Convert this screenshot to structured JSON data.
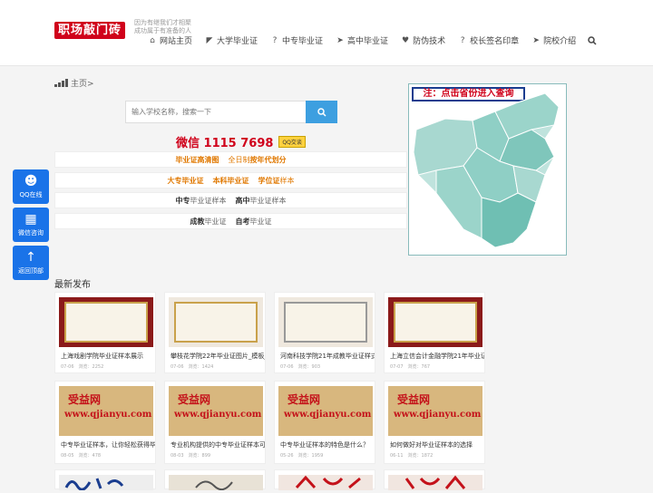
{
  "top_left_mark": "<",
  "logo": "职场敲门砖",
  "slogan": "因为有继我们才相聚 成功属于有准备的人",
  "nav": [
    {
      "icon": "home-icon",
      "glyph": "⌂",
      "label": "网站主页"
    },
    {
      "icon": "megaphone-icon",
      "glyph": "◤",
      "label": "大学毕业证"
    },
    {
      "icon": "question-circle-icon",
      "glyph": "?",
      "label": "中专毕业证"
    },
    {
      "icon": "paper-plane-icon",
      "glyph": "➤",
      "label": "高中毕业证"
    },
    {
      "icon": "heart-icon",
      "glyph": "♥",
      "label": "防伪技术"
    },
    {
      "icon": "question-circle-icon",
      "glyph": "?",
      "label": "校长签名印章"
    },
    {
      "icon": "paper-plane-icon",
      "glyph": "➤",
      "label": "院校介绍"
    }
  ],
  "breadcrumb": "主页>",
  "search": {
    "placeholder": "输入学校名称，搜索一下"
  },
  "wechat": {
    "text": "微信 1115 7698",
    "qq": "QQ交谈"
  },
  "rows": {
    "r1": {
      "a": "毕业证高清图",
      "b": "全日制",
      "c": "按年代划分"
    },
    "r2": {
      "a": "大专毕业证",
      "b": "本科毕业证",
      "c": "学位证",
      "d": "样本"
    },
    "r3": {
      "a": "中专",
      "b": "毕业证样本",
      "c": "高中",
      "d": "毕业证样本"
    },
    "r4": {
      "a": "成教",
      "b": "毕业证",
      "c": "自考",
      "d": "毕业证"
    }
  },
  "map": {
    "title": "注：点击省份进入查询"
  },
  "float": [
    {
      "icon": "qq-icon",
      "glyph": "☻",
      "label": "QQ在线"
    },
    {
      "icon": "qrcode-icon",
      "glyph": "▦",
      "label": "微信咨询"
    },
    {
      "icon": "arrow-up-icon",
      "glyph": "↑",
      "label": "返回顶部"
    }
  ],
  "latest_title": "最新发布",
  "cards": [
    {
      "title": "上海戏剧学院毕业证样本展示",
      "date": "07-06",
      "views": "浏览：2252"
    },
    {
      "title": "攀枝花学院22年毕业证图片_模板_",
      "date": "07-06",
      "views": "浏览：1424"
    },
    {
      "title": "河南科技学院21年成教毕业证样式",
      "date": "07-06",
      "views": "浏览：903"
    },
    {
      "title": "上海立信会计金融学院21年毕业证",
      "date": "07-07",
      "views": "浏览：767"
    },
    {
      "title": "中专毕业证样本，让你轻松获得毕",
      "date": "08-05",
      "views": "浏览：478"
    },
    {
      "title": "专业机构提供的中专毕业证样本可",
      "date": "08-03",
      "views": "浏览：899"
    },
    {
      "title": "中专毕业证样本的特色是什么？",
      "date": "05-26",
      "views": "浏览：1959"
    },
    {
      "title": "如何做好对毕业证样本的选择",
      "date": "06-11",
      "views": "浏览：1872"
    }
  ],
  "watermark": {
    "cn": "受益网",
    "url": "www.qjianyu.com"
  }
}
